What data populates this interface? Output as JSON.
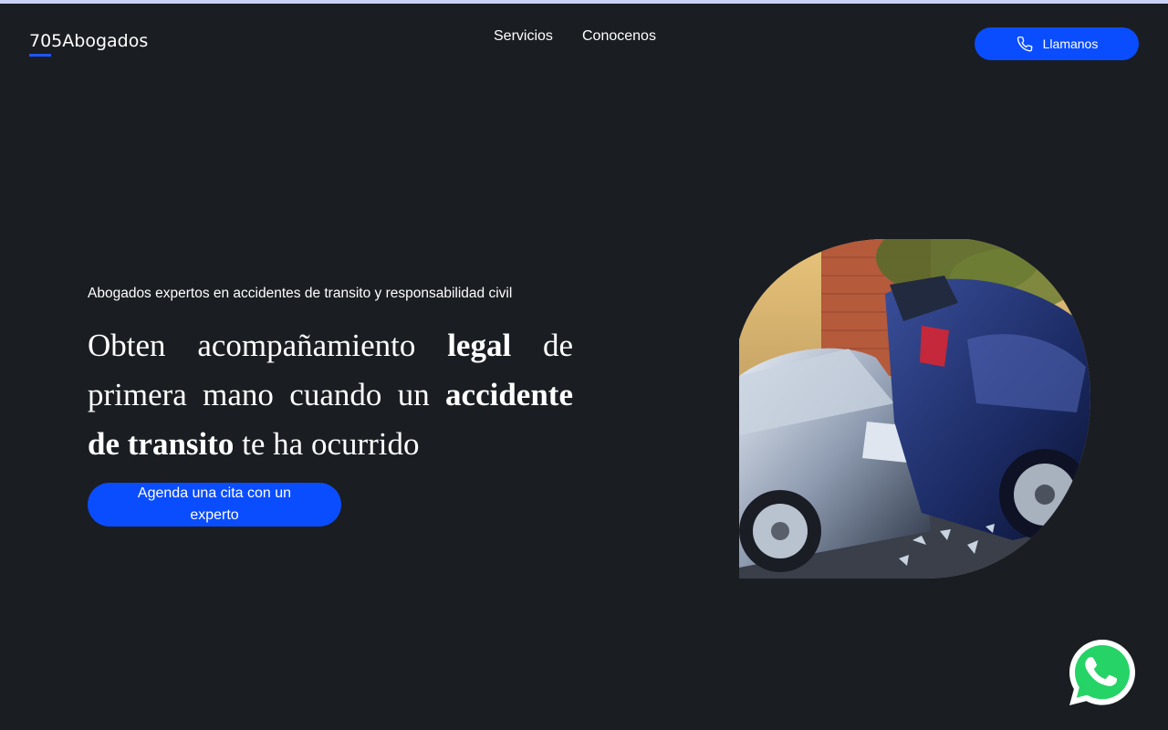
{
  "brand": {
    "name": "705Abogados",
    "accent": "#1f55ff"
  },
  "nav": {
    "items": [
      {
        "label": "Servicios"
      },
      {
        "label": "Conocenos"
      }
    ]
  },
  "call_button": {
    "label": "Llamanos",
    "icon": "phone-icon",
    "color": "#0a4dff"
  },
  "hero": {
    "eyebrow": "Abogados expertos en accidentes de transito y responsabilidad civil",
    "headline": {
      "part1": "Obten acompañamiento ",
      "bold1": "legal",
      "part2": " de primera mano cuando un ",
      "bold2": "accidente de transito",
      "part3": " te ha ocurrido"
    },
    "cta_label": "Agenda una cita con un experto",
    "image_icon": "car-crash-illustration"
  },
  "whatsapp": {
    "icon": "whatsapp-icon",
    "color": "#25d366"
  },
  "colors": {
    "background": "#1a1d22",
    "top_strip": "#c9d2f5"
  }
}
